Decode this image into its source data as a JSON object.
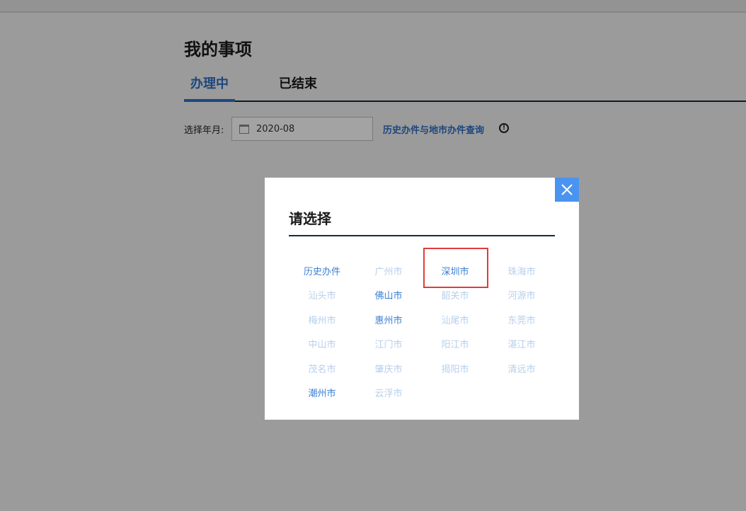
{
  "page": {
    "title": "我的事项",
    "tabs": [
      {
        "label": "办理中",
        "active": true
      },
      {
        "label": "已结束",
        "active": false
      }
    ],
    "filter": {
      "label": "选择年月:",
      "date_value": "2020-08",
      "calendar_icon": "calendar-icon"
    },
    "history_link": "历史办件与地市办件查询",
    "info_icon": "info-icon",
    "info_glyph": "!"
  },
  "modal": {
    "title": "请选择",
    "close_icon": "close-icon",
    "accent_color": "#4a93f0",
    "highlight_color": "#e23b3b",
    "cities": [
      {
        "label": "历史办件",
        "enabled": true
      },
      {
        "label": "广州市",
        "enabled": false
      },
      {
        "label": "深圳市",
        "enabled": true
      },
      {
        "label": "珠海市",
        "enabled": false
      },
      {
        "label": "汕头市",
        "enabled": false
      },
      {
        "label": "佛山市",
        "enabled": true
      },
      {
        "label": "韶关市",
        "enabled": false
      },
      {
        "label": "河源市",
        "enabled": false
      },
      {
        "label": "梅州市",
        "enabled": false
      },
      {
        "label": "惠州市",
        "enabled": true
      },
      {
        "label": "汕尾市",
        "enabled": false
      },
      {
        "label": "东莞市",
        "enabled": false
      },
      {
        "label": "中山市",
        "enabled": false
      },
      {
        "label": "江门市",
        "enabled": false
      },
      {
        "label": "阳江市",
        "enabled": false
      },
      {
        "label": "湛江市",
        "enabled": false
      },
      {
        "label": "茂名市",
        "enabled": false
      },
      {
        "label": "肇庆市",
        "enabled": false
      },
      {
        "label": "揭阳市",
        "enabled": false
      },
      {
        "label": "清远市",
        "enabled": false
      },
      {
        "label": "潮州市",
        "enabled": true
      },
      {
        "label": "云浮市",
        "enabled": false
      }
    ]
  }
}
